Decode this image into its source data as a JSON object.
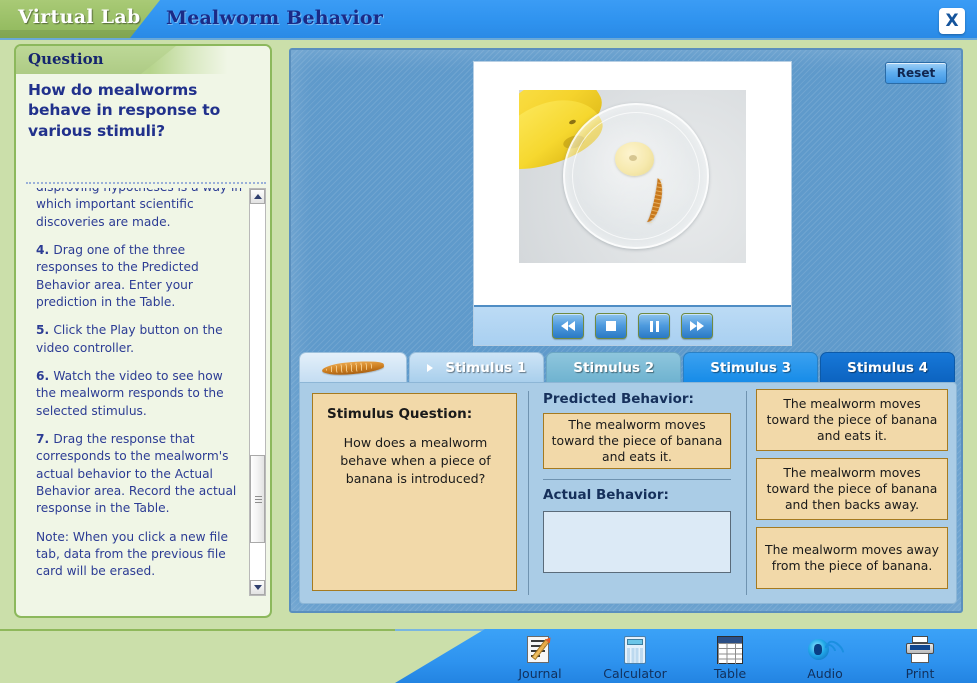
{
  "header": {
    "brand": "Virtual Lab",
    "title": "Mealworm Behavior",
    "close_label": "X",
    "close_icon": "close-icon"
  },
  "question_panel": {
    "header_label": "Question",
    "title": "How do mealworms behave in response to various stimuli?",
    "instructions": [
      {
        "num": "",
        "text": "disproving hypotheses is a way in which important scientific discoveries are made."
      },
      {
        "num": "4.",
        "text": "Drag one of the three responses to the Predicted Behavior area. Enter your prediction in the Table."
      },
      {
        "num": "5.",
        "text": "Click the Play button on the video controller."
      },
      {
        "num": "6.",
        "text": "Watch the video to see how the mealworm responds to the selected stimulus."
      },
      {
        "num": "7.",
        "text": "Drag the response that corresponds to the mealworm's actual behavior to the Actual Behavior area. Record the actual response in the Table."
      },
      {
        "num": "",
        "text": "Note: When you click a new file tab, data from the previous file card will be erased."
      }
    ]
  },
  "main": {
    "reset_label": "Reset",
    "video_controls": [
      {
        "name": "rewind-button",
        "icon": "rewind-icon"
      },
      {
        "name": "stop-button",
        "icon": "stop-icon"
      },
      {
        "name": "pause-button",
        "icon": "pause-icon"
      },
      {
        "name": "fast-forward-button",
        "icon": "fast-forward-icon"
      }
    ]
  },
  "tabs": [
    {
      "id": "tab-worm",
      "label": "",
      "icon": "mealworm-icon",
      "active": false
    },
    {
      "id": "tab-s1",
      "label": "Stimulus 1",
      "active": true
    },
    {
      "id": "tab-s2",
      "label": "Stimulus 2",
      "active": false
    },
    {
      "id": "tab-s3",
      "label": "Stimulus 3",
      "active": false
    },
    {
      "id": "tab-s4",
      "label": "Stimulus 4",
      "active": false
    }
  ],
  "card": {
    "stimulus_question_label": "Stimulus Question:",
    "stimulus_question_text": "How does a mealworm behave when a piece of banana is introduced?",
    "predicted_label": "Predicted Behavior:",
    "predicted_value": "The mealworm moves toward the piece of banana and eats it.",
    "actual_label": "Actual Behavior:",
    "actual_value": "",
    "choices": [
      "The mealworm moves toward the piece of banana and eats it.",
      "The mealworm moves toward the piece of banana and then backs away.",
      "The mealworm moves away from the piece of banana."
    ]
  },
  "toolbar": [
    {
      "label": "Journal",
      "icon": "journal-icon"
    },
    {
      "label": "Calculator",
      "icon": "calculator-icon"
    },
    {
      "label": "Table",
      "icon": "table-icon"
    },
    {
      "label": "Audio",
      "icon": "audio-icon"
    },
    {
      "label": "Print",
      "icon": "print-icon"
    }
  ],
  "colors": {
    "page_bg": "#cbdfaa",
    "header_blue": "#3399f2",
    "header_green": "#8fb85b",
    "panel_blue": "#5f9acb",
    "card_blue": "#aacce6",
    "tan": "#f2d9a9",
    "tan_border": "#a57a20",
    "title_navy": "#21318c"
  }
}
